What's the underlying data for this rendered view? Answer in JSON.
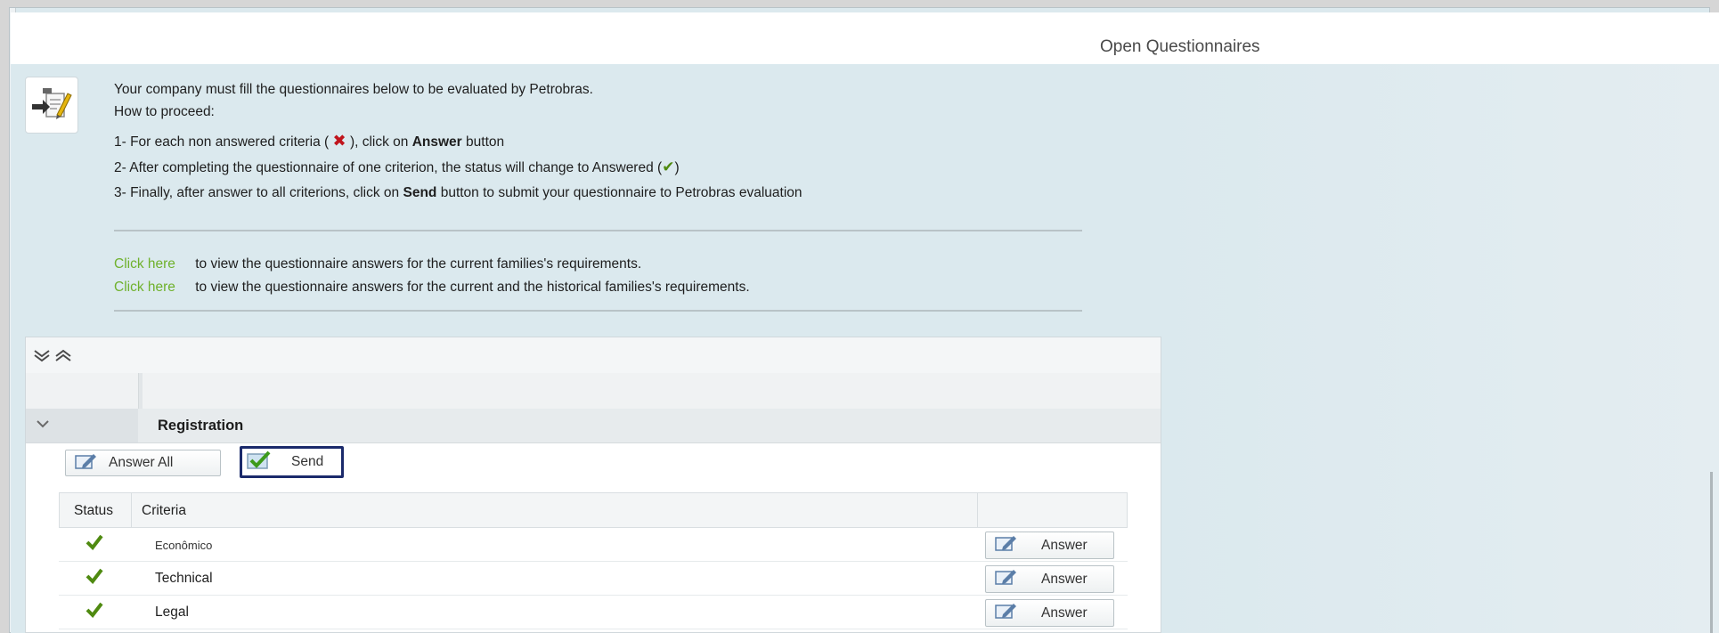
{
  "header": {
    "title": "Open Questionnaires"
  },
  "intro": {
    "line1": "Your company must fill the questionnaires below to be evaluated by Petrobras.",
    "line2": "How to proceed:",
    "step1_prefix": "1- For each non answered criteria (",
    "step1_mid": "), click on",
    "step1_bold": "Answer",
    "step1_suffix": "button",
    "step2_prefix": "2- After completing the questionnaire of one criterion, the status will change to Answered (",
    "step2_suffix": ")",
    "step3_prefix": "3- Finally, after answer to all criterions, click on",
    "step3_bold": "Send",
    "step3_suffix": "button to submit your questionnaire to Petrobras evaluation"
  },
  "links": [
    {
      "link": "Click here",
      "text": "to view the questionnaire answers for the current families's requirements."
    },
    {
      "link": "Click here",
      "text": "to view the questionnaire answers for the current and the historical families's requirements."
    }
  ],
  "icons": {
    "intro": "questionnaire-edit-icon",
    "not_answered": "red-x-icon",
    "answered": "green-check-icon",
    "expand_all": "expand-all-icon",
    "collapse_all": "collapse-all-icon",
    "group_toggle": "chevron-down-icon",
    "answer_all": "edit-pencil-icon",
    "send": "send-check-icon",
    "answer": "edit-pencil-icon"
  },
  "group": {
    "label": "Registration"
  },
  "actions": {
    "answer_all_label": "Answer All",
    "send_label": "Send"
  },
  "table": {
    "columns": [
      "Status",
      "Criteria"
    ],
    "rows": [
      {
        "status": "answered",
        "criteria": "Econômico",
        "action": "Answer"
      },
      {
        "status": "answered",
        "criteria": "Technical",
        "action": "Answer"
      },
      {
        "status": "answered",
        "criteria": "Legal",
        "action": "Answer"
      }
    ]
  },
  "colors": {
    "link": "#6fb12c",
    "check": "#4f8a10",
    "cross": "#c0141c",
    "highlight": "#1b2a6b"
  }
}
